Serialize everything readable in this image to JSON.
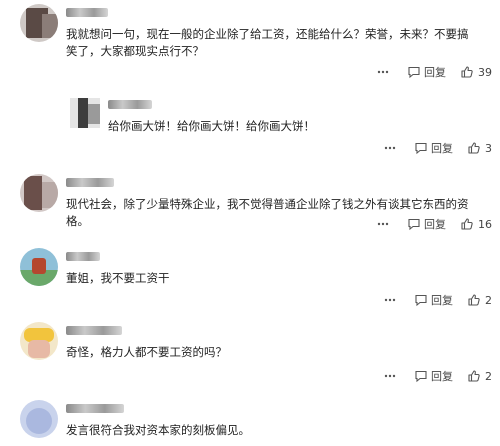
{
  "comments": [
    {
      "text": "我就想问一句，现在一般的企业除了给工资，还能给什么？荣誉，未来？不要搞笑了，大家都现实点行不？",
      "reply_label": "回复",
      "likes": "39"
    },
    {
      "text": "给你画大饼！给你画大饼！给你画大饼！",
      "reply_label": "回复",
      "likes": "3"
    },
    {
      "text": "现代社会，除了少量特殊企业，我不觉得普通企业除了钱之外有谈其它东西的资格。",
      "reply_label": "回复",
      "likes": "16"
    },
    {
      "text": "董姐，我不要工资干",
      "reply_label": "回复",
      "likes": "2"
    },
    {
      "text": "奇怪，格力人都不要工资的吗？",
      "reply_label": "回复",
      "likes": "2"
    },
    {
      "text": "发言很符合我对资本家的刻板偏见。",
      "reply_label": "",
      "likes": ""
    }
  ],
  "icons": {
    "more": "ellipsis-icon",
    "reply": "reply-bubble-icon",
    "like": "thumbs-up-icon"
  }
}
